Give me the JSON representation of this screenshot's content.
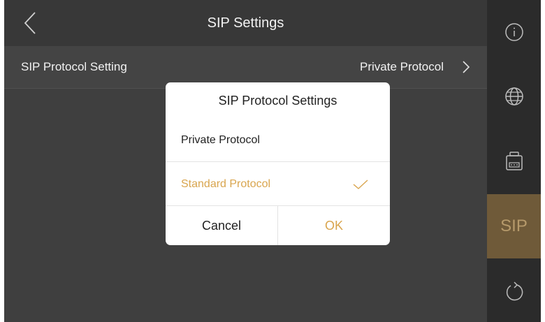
{
  "header": {
    "title": "SIP Settings",
    "back_icon": "chevron-left-icon"
  },
  "settings_row": {
    "label": "SIP Protocol Setting",
    "value": "Private Protocol",
    "chevron_icon": "chevron-right-icon"
  },
  "sidebar": {
    "items": [
      {
        "icon": "info-icon",
        "active": false
      },
      {
        "icon": "globe-icon",
        "active": false
      },
      {
        "icon": "intercom-device-icon",
        "active": false
      },
      {
        "icon": "sip-text",
        "label": "SIP",
        "active": true
      },
      {
        "icon": "refresh-icon",
        "active": false
      }
    ]
  },
  "dialog": {
    "title": "SIP Protocol Settings",
    "options": [
      {
        "label": "Private Protocol",
        "selected": false
      },
      {
        "label": "Standard Protocol",
        "selected": true
      }
    ],
    "cancel_label": "Cancel",
    "ok_label": "OK"
  },
  "colors": {
    "accent": "#d9a54e",
    "sidebar_active": "#6f5a39",
    "background": "#3f3f3f"
  }
}
